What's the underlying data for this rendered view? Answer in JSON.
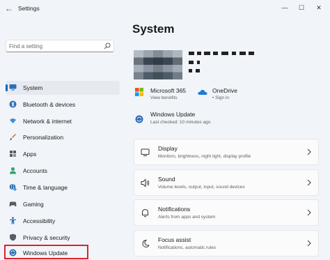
{
  "window": {
    "title": "Settings",
    "minimize": "—",
    "maximize": "☐",
    "close": "✕"
  },
  "search": {
    "placeholder": "Find a setting"
  },
  "nav": [
    {
      "label": "System",
      "icon": "monitor-icon",
      "color": "#2f6db5"
    },
    {
      "label": "Bluetooth & devices",
      "icon": "bluetooth-icon",
      "color": "#2f6db5"
    },
    {
      "label": "Network & internet",
      "icon": "wifi-icon",
      "color": "#3b8fd6"
    },
    {
      "label": "Personalization",
      "icon": "brush-icon",
      "color": "#c46f2c"
    },
    {
      "label": "Apps",
      "icon": "apps-icon",
      "color": "#555c66"
    },
    {
      "label": "Accounts",
      "icon": "person-icon",
      "color": "#2fa36b"
    },
    {
      "label": "Time & language",
      "icon": "globe-clock-icon",
      "color": "#2f6db5"
    },
    {
      "label": "Gaming",
      "icon": "gamepad-icon",
      "color": "#555c66"
    },
    {
      "label": "Accessibility",
      "icon": "accessibility-icon",
      "color": "#2f6db5"
    },
    {
      "label": "Privacy & security",
      "icon": "shield-icon",
      "color": "#555c66"
    },
    {
      "label": "Windows Update",
      "icon": "update-icon",
      "color": "#2f6db5"
    }
  ],
  "main": {
    "title": "System",
    "links": [
      {
        "title": "Microsoft 365",
        "sub": "View benefits",
        "icon": "microsoft-365-icon"
      },
      {
        "title": "OneDrive",
        "sub": "• Sign in",
        "icon": "onedrive-icon"
      },
      {
        "title": "Windows Update",
        "sub": "Last checked: 10 minutes ago",
        "icon": "windows-update-icon"
      }
    ],
    "cards": [
      {
        "title": "Display",
        "sub": "Monitors, brightness, night light, display profile",
        "icon": "display-icon"
      },
      {
        "title": "Sound",
        "sub": "Volume levels, output, input, sound devices",
        "icon": "speaker-icon"
      },
      {
        "title": "Notifications",
        "sub": "Alerts from apps and system",
        "icon": "bell-icon"
      },
      {
        "title": "Focus assist",
        "sub": "Notifications, automatic rules",
        "icon": "moon-icon"
      }
    ]
  },
  "colors": {
    "accent": "#0067c0",
    "highlight": "#d9252b",
    "background": "#f1f4f9"
  }
}
